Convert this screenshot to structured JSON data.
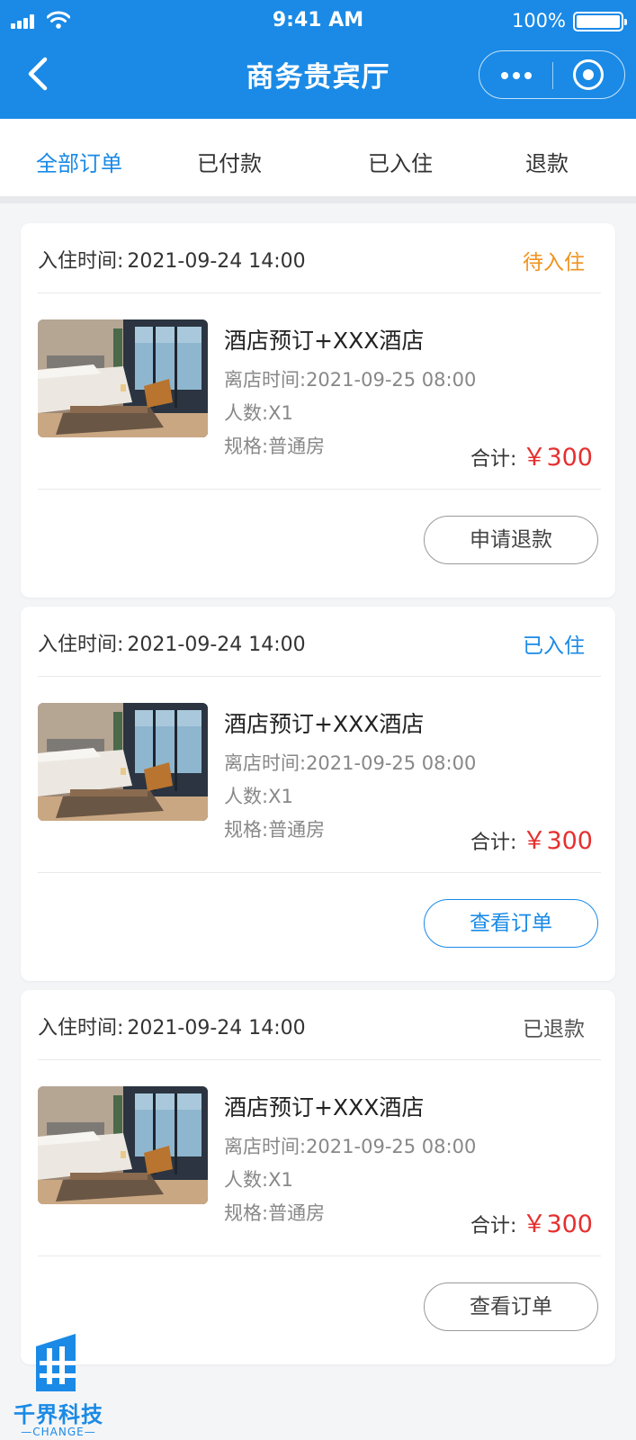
{
  "status_bar": {
    "time": "9:41 AM",
    "battery": "100%"
  },
  "nav": {
    "title": "商务贵宾厅"
  },
  "tabs": [
    {
      "label": "全部订单",
      "active": true
    },
    {
      "label": "已付款",
      "active": false
    },
    {
      "label": "已入住",
      "active": false
    },
    {
      "label": "退款",
      "active": false
    }
  ],
  "orders": [
    {
      "checkin_label": "入住时间:",
      "checkin_time": "2021-09-24  14:00",
      "status": "待入住",
      "status_color": "#f0931f",
      "hotel_name": "酒店预订+XXX酒店",
      "checkout": "离店时间:2021-09-25  08:00",
      "guests": "人数:X1",
      "room_type": "规格:普通房",
      "total_label": "合计:",
      "total_amount": "￥300",
      "action": "申请退款"
    },
    {
      "checkin_label": "入住时间:",
      "checkin_time": "2021-09-24  14:00",
      "status": "已入住",
      "status_color": "#1a8ae6",
      "hotel_name": "酒店预订+XXX酒店",
      "checkout": "离店时间:2021-09-25  08:00",
      "guests": "人数:X1",
      "room_type": "规格:普通房",
      "total_label": "合计:",
      "total_amount": "￥300",
      "action": "查看订单"
    },
    {
      "checkin_label": "入住时间:",
      "checkin_time": "2021-09-24  14:00",
      "status": "已退款",
      "status_color": "#555555",
      "hotel_name": "酒店预订+XXX酒店",
      "checkout": "离店时间:2021-09-25  08:00",
      "guests": "人数:X1",
      "room_type": "规格:普通房",
      "total_label": "合计:",
      "total_amount": "￥300",
      "action": "查看订单"
    }
  ],
  "watermark": {
    "name": "千界科技",
    "sub": "CHANGE"
  },
  "colors": {
    "brand": "#1a8ae6",
    "price": "#e62f2f",
    "pending": "#f0931f"
  }
}
